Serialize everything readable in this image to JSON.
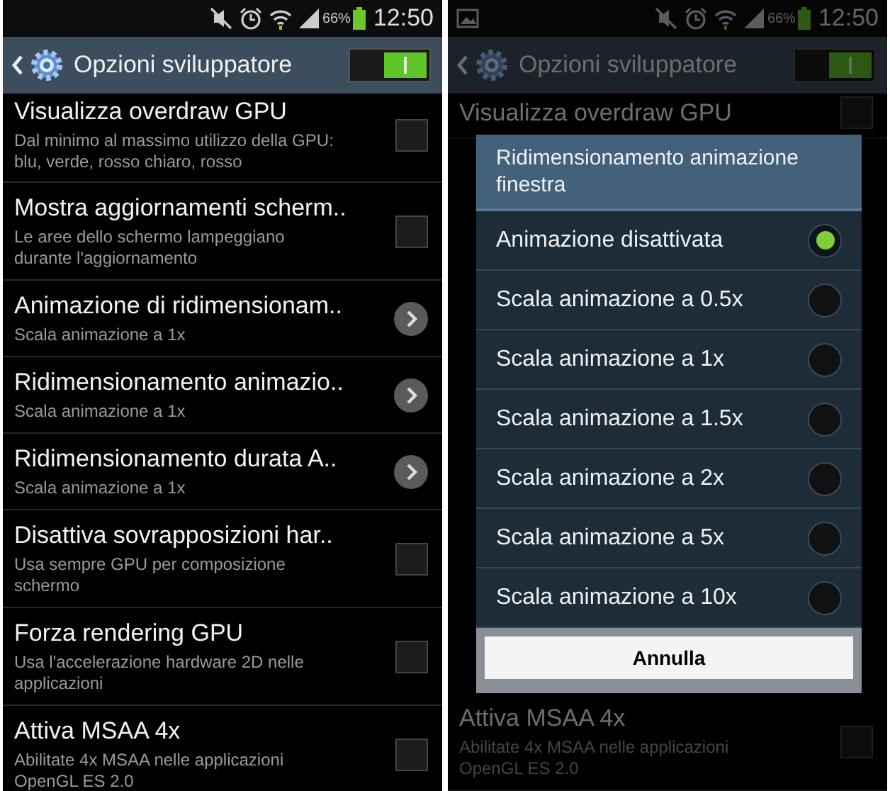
{
  "screens": [
    {
      "status_bar": {
        "picture_notification": false,
        "battery": "66%",
        "time": "12:50"
      },
      "action_bar": {
        "title": "Opzioni sviluppatore",
        "toggle_on": true
      },
      "dimmed": false,
      "top_items": [
        {
          "kind": "checkbox",
          "title": "Visualizza overdraw GPU",
          "description": "Dal minimo al massimo utilizzo della GPU: blu, verde, rosso chiaro, rosso",
          "checked": false
        },
        {
          "kind": "checkbox",
          "title": "Mostra aggiornamenti scherm..",
          "description": "Le aree dello schermo lampeggiano durante l'aggiornamento",
          "checked": false
        },
        {
          "kind": "arrow",
          "title": "Animazione di ridimensionam..",
          "description": "Scala animazione a 1x"
        },
        {
          "kind": "arrow",
          "title": "Ridimensionamento animazio..",
          "description": "Scala animazione a 1x"
        },
        {
          "kind": "arrow",
          "title": "Ridimensionamento durata A..",
          "description": "Scala animazione a 1x"
        },
        {
          "kind": "checkbox",
          "title": "Disattiva sovrapposizioni har..",
          "description": "Usa sempre GPU per composizione schermo",
          "checked": false
        },
        {
          "kind": "checkbox",
          "title": "Forza rendering GPU",
          "description": "Usa l'accelerazione hardware 2D nelle applicazioni",
          "checked": false
        }
      ],
      "bottom_items": [
        {
          "kind": "checkbox",
          "title": "Attiva MSAA 4x",
          "description": "Abilitate 4x MSAA nelle applicazioni OpenGL ES 2.0",
          "checked": false
        }
      ]
    },
    {
      "status_bar": {
        "picture_notification": true,
        "battery": "66%",
        "time": "12:50"
      },
      "action_bar": {
        "title": "Opzioni sviluppatore",
        "toggle_on": true
      },
      "dimmed": true,
      "top_items": [
        {
          "kind": "checkbox",
          "title": "Visualizza overdraw GPU",
          "checked": false
        }
      ],
      "bottom_items": [
        {
          "kind": "checkbox",
          "title": "Attiva MSAA 4x",
          "description": "Abilitate 4x MSAA nelle applicazioni OpenGL ES 2.0",
          "checked": false
        }
      ],
      "dialog": {
        "title": "Ridimensionamento animazione finestra",
        "options": [
          {
            "label": "Animazione disattivata",
            "selected": true
          },
          {
            "label": "Scala animazione a 0.5x",
            "selected": false
          },
          {
            "label": "Scala animazione a 1x",
            "selected": false
          },
          {
            "label": "Scala animazione a 1.5x",
            "selected": false
          },
          {
            "label": "Scala animazione a 2x",
            "selected": false
          },
          {
            "label": "Scala animazione a 5x",
            "selected": false
          },
          {
            "label": "Scala animazione a 10x",
            "selected": false
          }
        ],
        "button": "Annulla"
      }
    }
  ]
}
